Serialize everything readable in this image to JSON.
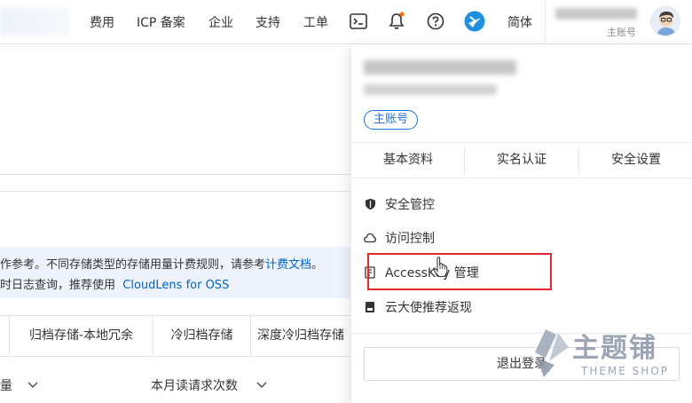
{
  "nav": {
    "billing": "费用",
    "icp": "ICP 备案",
    "enterprise": "企业",
    "support": "支持",
    "ticket": "工单",
    "language": "简体"
  },
  "user": {
    "role": "主账号"
  },
  "page": {
    "info_line1_pre": "作参考。不同存储类型的存储用量计费规则，请参考",
    "info_line1_link": "计费文档",
    "info_line1_post": "。",
    "info_line2_pre": "时日志查询，推荐使用",
    "info_line2_link": "CloudLens for OSS",
    "tabs": [
      "归档存储-本地冗余",
      "冷归档存储",
      "深度冷归档存储"
    ],
    "select_left": "量",
    "select_right": "本月读请求次数"
  },
  "dropdown": {
    "badge": "主账号",
    "tabs": [
      "基本资料",
      "实名认证",
      "安全设置"
    ],
    "menu": [
      "安全管控",
      "访问控制",
      "AccessKey 管理",
      "云大使推荐返现"
    ],
    "logout": "退出登录"
  },
  "watermark": {
    "title": "主题铺",
    "subtitle": "THEME SHOP"
  },
  "colors": {
    "accent": "#1f6fd6",
    "link": "#0064c8",
    "highlight": "#e0282e",
    "notification_dot": "#ff6a00"
  }
}
